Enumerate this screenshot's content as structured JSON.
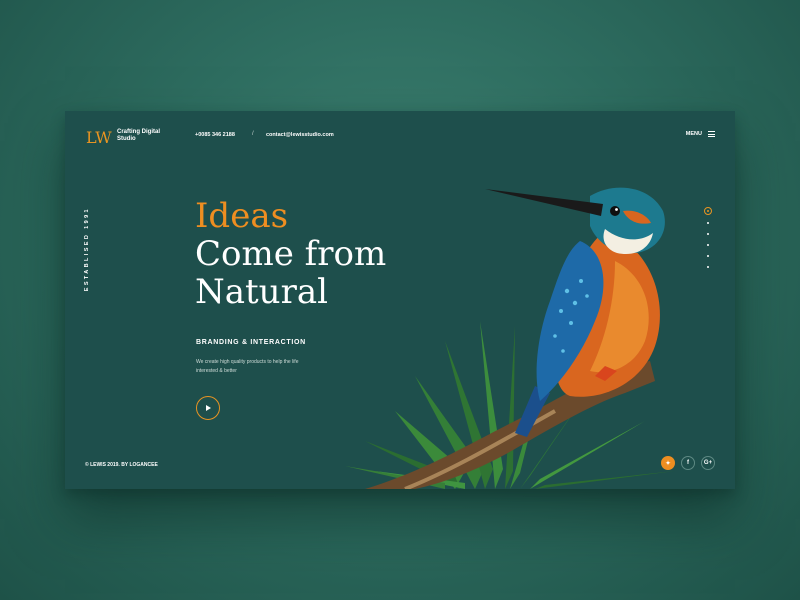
{
  "brand": {
    "logo": "LW",
    "tagline": "Crafting Digital Studio"
  },
  "header": {
    "phone": "+0085 346 2188",
    "separator": "/",
    "email": "contact@lewisstudio.com",
    "menu_label": "MENU"
  },
  "side": {
    "established": "ESTABLISED 1991"
  },
  "hero": {
    "accent_word": "Ideas",
    "line2": "Come from",
    "line3": "Natural",
    "subhead": "BRANDING & INTERACTION",
    "description": "We create high quality products to help the life interested & better"
  },
  "footer": {
    "copyright": "© LEWIS 2019. BY LOGANCEE"
  },
  "slides": {
    "count": 6,
    "active": 1
  },
  "social": [
    {
      "name": "twitter",
      "glyph": "✦"
    },
    {
      "name": "facebook",
      "glyph": "f"
    },
    {
      "name": "google-plus",
      "glyph": "G+"
    }
  ],
  "colors": {
    "accent": "#ee8e21",
    "panel": "#1e4f4c",
    "background": "#2e6d60"
  }
}
